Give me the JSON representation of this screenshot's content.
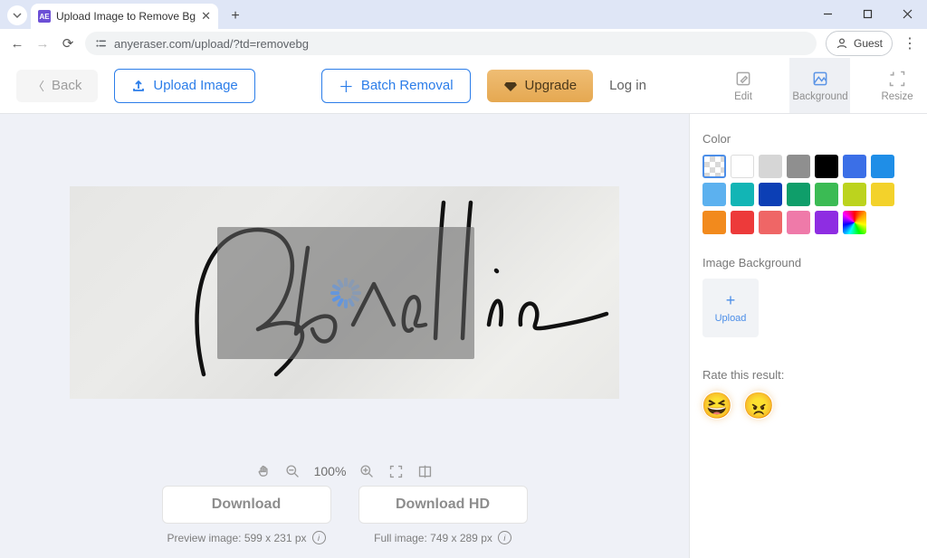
{
  "browser": {
    "tab_title": "Upload Image to Remove Bg",
    "tab_favicon": "AE",
    "url": "anyeraser.com/upload/?td=removebg",
    "guest_label": "Guest"
  },
  "header": {
    "back_label": "Back",
    "upload_label": "Upload Image",
    "batch_label": "Batch Removal",
    "upgrade_label": "Upgrade",
    "login_label": "Log in",
    "tools": {
      "edit": "Edit",
      "background": "Background",
      "resize": "Resize"
    }
  },
  "editor": {
    "signature_text": "Ravellin",
    "zoom_label": "100%",
    "download_label": "Download",
    "download_hd_label": "Download HD",
    "preview_info": "Preview image: 599 x 231 px",
    "full_info": "Full image: 749 x 289 px"
  },
  "panel": {
    "color_heading": "Color",
    "colors": [
      "transparent",
      "#ffffff",
      "#d6d6d6",
      "#8f8f8f",
      "#000000",
      "#3b6fe7",
      "#1f8ee7",
      "#5cb1ef",
      "#12b5b5",
      "#0c3fb5",
      "#0f9e6a",
      "#3bbb54",
      "#bcd31e",
      "#f3d22b",
      "#f28a1d",
      "#ed3a3a",
      "#ef6666",
      "#ef7aa9",
      "#8e2de2",
      "rainbow"
    ],
    "image_bg_heading": "Image Background",
    "upload_label": "Upload",
    "rate_heading": "Rate this result:"
  }
}
